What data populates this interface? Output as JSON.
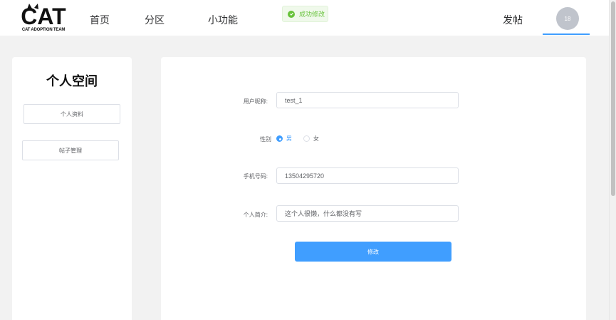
{
  "header": {
    "logo_text": "CAT",
    "logo_subtitle": "CAT ADOPTION TEAM",
    "nav": [
      {
        "label": "首页"
      },
      {
        "label": "分区"
      },
      {
        "label": "小功能"
      }
    ],
    "post_label": "发帖",
    "avatar_label": "18"
  },
  "toast": {
    "text": "成功修改",
    "color": "#67c23a"
  },
  "sidebar": {
    "title": "个人空间",
    "items": [
      {
        "label": "个人资料"
      },
      {
        "label": "帖子管理"
      }
    ]
  },
  "form": {
    "nickname": {
      "label": "用户昵称:",
      "value": "test_1"
    },
    "gender": {
      "label": "性别",
      "options": [
        "男",
        "女"
      ],
      "selected": "男"
    },
    "phone": {
      "label": "手机号码:",
      "value": "13504295720"
    },
    "bio": {
      "label": "个人简介:",
      "value": "这个人很懒，什么都没有写"
    },
    "submit_label": "修改"
  },
  "colors": {
    "accent": "#409eff",
    "background": "#f2f2f2"
  }
}
